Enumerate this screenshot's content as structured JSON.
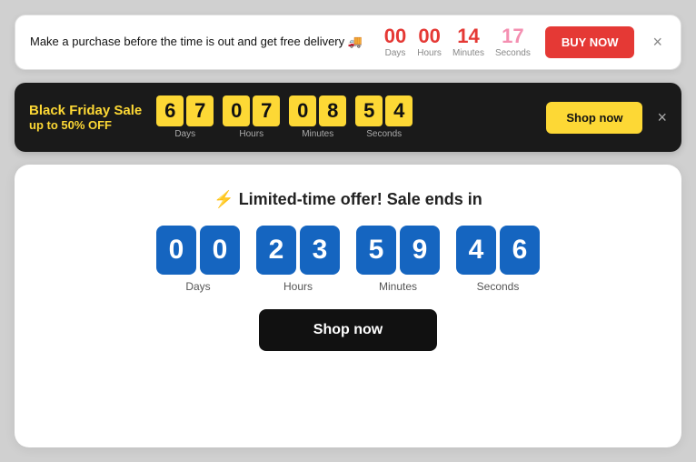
{
  "banner1": {
    "text": "Make a purchase before the time is out and get free delivery 🚚",
    "days": {
      "value": "00",
      "label": "Days"
    },
    "hours": {
      "value": "00",
      "label": "Hours"
    },
    "minutes": {
      "value": "14",
      "label": "Minutes"
    },
    "seconds": {
      "value": "17",
      "label": "Seconds"
    },
    "buy_btn": "BUY NOW",
    "close": "×"
  },
  "banner2": {
    "title_top": "Black Friday Sale",
    "title_sub": "up to 50% OFF",
    "days": {
      "d1": "6",
      "d2": "7",
      "label": "Days"
    },
    "hours": {
      "d1": "0",
      "d2": "7",
      "label": "Hours"
    },
    "minutes": {
      "d1": "0",
      "d2": "8",
      "label": "Minutes"
    },
    "seconds": {
      "d1": "5",
      "d2": "4",
      "label": "Seconds"
    },
    "shop_btn": "Shop now",
    "close": "×"
  },
  "banner3": {
    "icon": "⚡",
    "title": "Limited-time offer! Sale ends in",
    "days": {
      "d1": "0",
      "d2": "0",
      "label": "Days"
    },
    "hours": {
      "d1": "2",
      "d2": "3",
      "label": "Hours"
    },
    "minutes": {
      "d1": "5",
      "d2": "9",
      "label": "Minutes"
    },
    "seconds": {
      "d1": "4",
      "d2": "6",
      "label": "Seconds"
    },
    "shop_btn": "Shop now"
  }
}
